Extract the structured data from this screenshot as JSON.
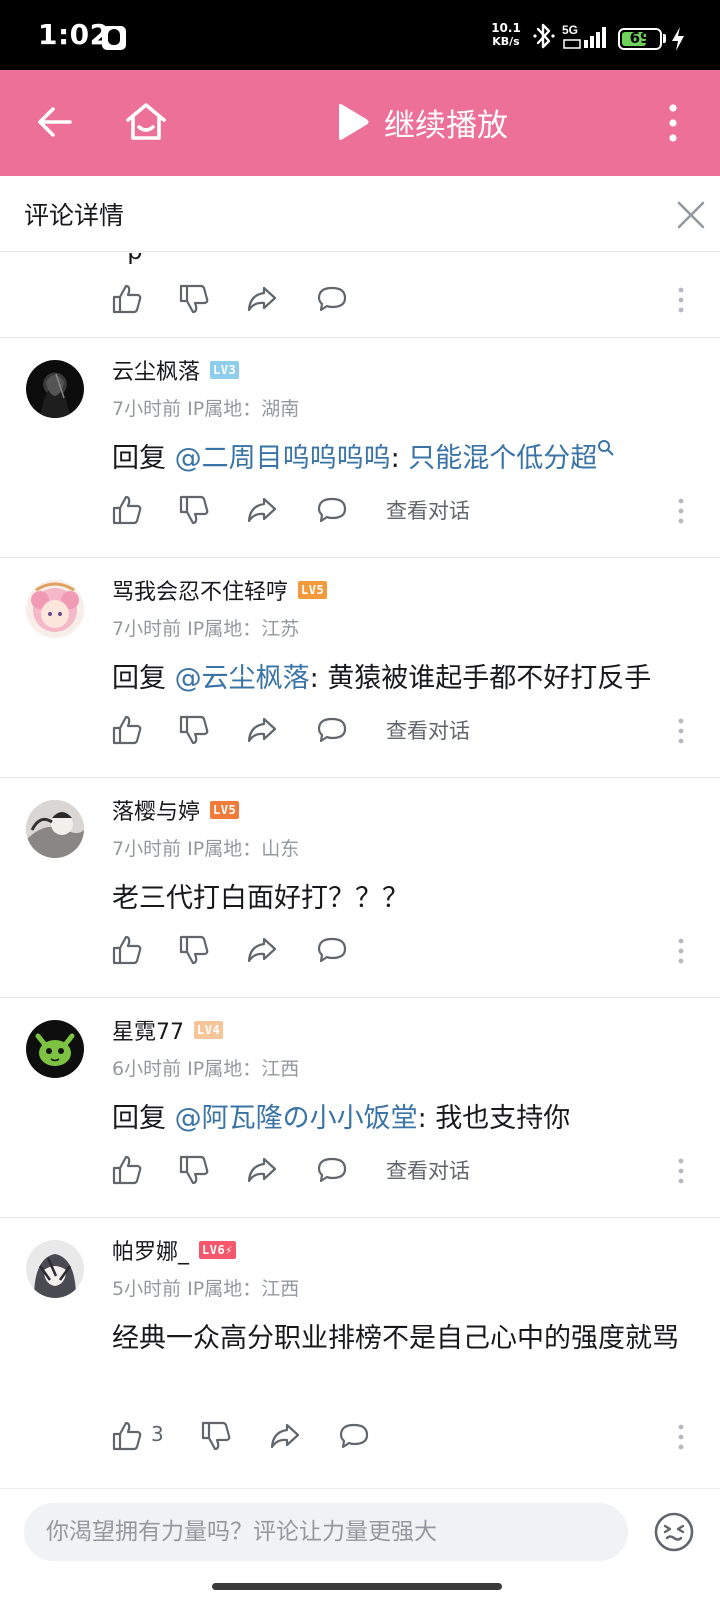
{
  "status_bar": {
    "time": "1:02",
    "net_speed_value": "10.1",
    "net_speed_unit": "KB/s",
    "network": "5G",
    "battery": "69",
    "battery_level": 0.69
  },
  "top_bar": {
    "title": "继续播放"
  },
  "detail": {
    "title": "评论详情"
  },
  "stub": {
    "text": "· p"
  },
  "action_labels": {
    "view_conversation": "查看对话"
  },
  "comments": [
    {
      "username": "云尘枫落",
      "level": "LV3",
      "level_color": "#8fcdec",
      "time": "7小时前",
      "ip_label": "IP属地：",
      "ip": "湖南",
      "reply_prefix": "回复 ",
      "mention": "@二周目呜呜呜呜",
      "colon": ": ",
      "text": "只能混个低分超",
      "text_is_link": true,
      "has_conversation": true
    },
    {
      "username": "骂我会忍不住轻哼",
      "level": "LV5",
      "level_color": "#f39a3c",
      "time": "7小时前",
      "ip_label": "IP属地：",
      "ip": "江苏",
      "reply_prefix": "回复 ",
      "mention": "@云尘枫落",
      "colon": ": ",
      "text": "黄猿被谁起手都不好打反手",
      "text_is_link": false,
      "has_conversation": true
    },
    {
      "username": "落樱与婷",
      "level": "LV5",
      "level_color": "#f07b3a",
      "time": "7小时前",
      "ip_label": "IP属地：",
      "ip": "山东",
      "text": "老三代打白面好打？？？",
      "has_conversation": false
    },
    {
      "username": "星霓77",
      "level": "LV4",
      "level_color": "#f7c59a",
      "time": "6小时前",
      "ip_label": "IP属地：",
      "ip": "江西",
      "reply_prefix": "回复 ",
      "mention": "@阿瓦隆の小小饭堂",
      "colon": ": ",
      "text": "我也支持你",
      "text_is_link": false,
      "has_conversation": true
    },
    {
      "username": "帕罗娜_",
      "level": "LV6⚡",
      "level_color": "#f5576c",
      "time": "5小时前",
      "ip_label": "IP属地：",
      "ip": "江西",
      "text": "经典一众高分职业排榜不是自己心中的强度就骂",
      "likes": "3",
      "has_conversation": false
    }
  ],
  "input": {
    "placeholder": "你渴望拥有力量吗？评论让力量更强大"
  },
  "icons": {
    "back": "back-arrow-icon",
    "home": "home-icon",
    "play": "play-icon",
    "more": "more-vertical-icon",
    "close": "close-icon",
    "like": "thumbs-up-icon",
    "dislike": "thumbs-down-icon",
    "share": "share-icon",
    "reply": "comment-bubble-icon",
    "emoji": "emoji-icon"
  },
  "colors": {
    "accent": "#ec7097",
    "link": "#3a73a6",
    "muted": "#9499a0"
  }
}
